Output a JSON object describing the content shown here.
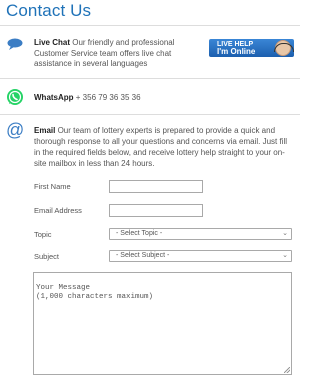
{
  "page": {
    "title": "Contact Us"
  },
  "live_chat": {
    "heading": "Live Chat",
    "text": " Our friendly and professional Customer Service team offers live chat assistance in several languages",
    "button_line1": "LIVE HELP",
    "button_line2": "I'm Online",
    "icon": "chat-bubble-icon"
  },
  "whatsapp": {
    "heading": "WhatsApp",
    "text": " + 356 79 36 35 36",
    "icon": "whatsapp-icon",
    "brand_color": "#25d366"
  },
  "email": {
    "heading": "Email",
    "text": " Our team of lottery experts is prepared to provide a quick and thorough response to all your questions and concerns via email. Just fill in the required fields below, and receive lottery help straight to your on-site mailbox in less than 24 hours.",
    "icon": "at-sign-icon"
  },
  "form": {
    "first_name_label": "First Name",
    "first_name_value": "",
    "email_label": "Email Address",
    "email_value": "",
    "topic_label": "Topic",
    "topic_selected": "- Select Topic -",
    "subject_label": "Subject",
    "subject_selected": "- Select Subject -",
    "message_placeholder": "Your Message\n(1,000 characters maximum)"
  },
  "colors": {
    "accent": "#1f72b8"
  }
}
